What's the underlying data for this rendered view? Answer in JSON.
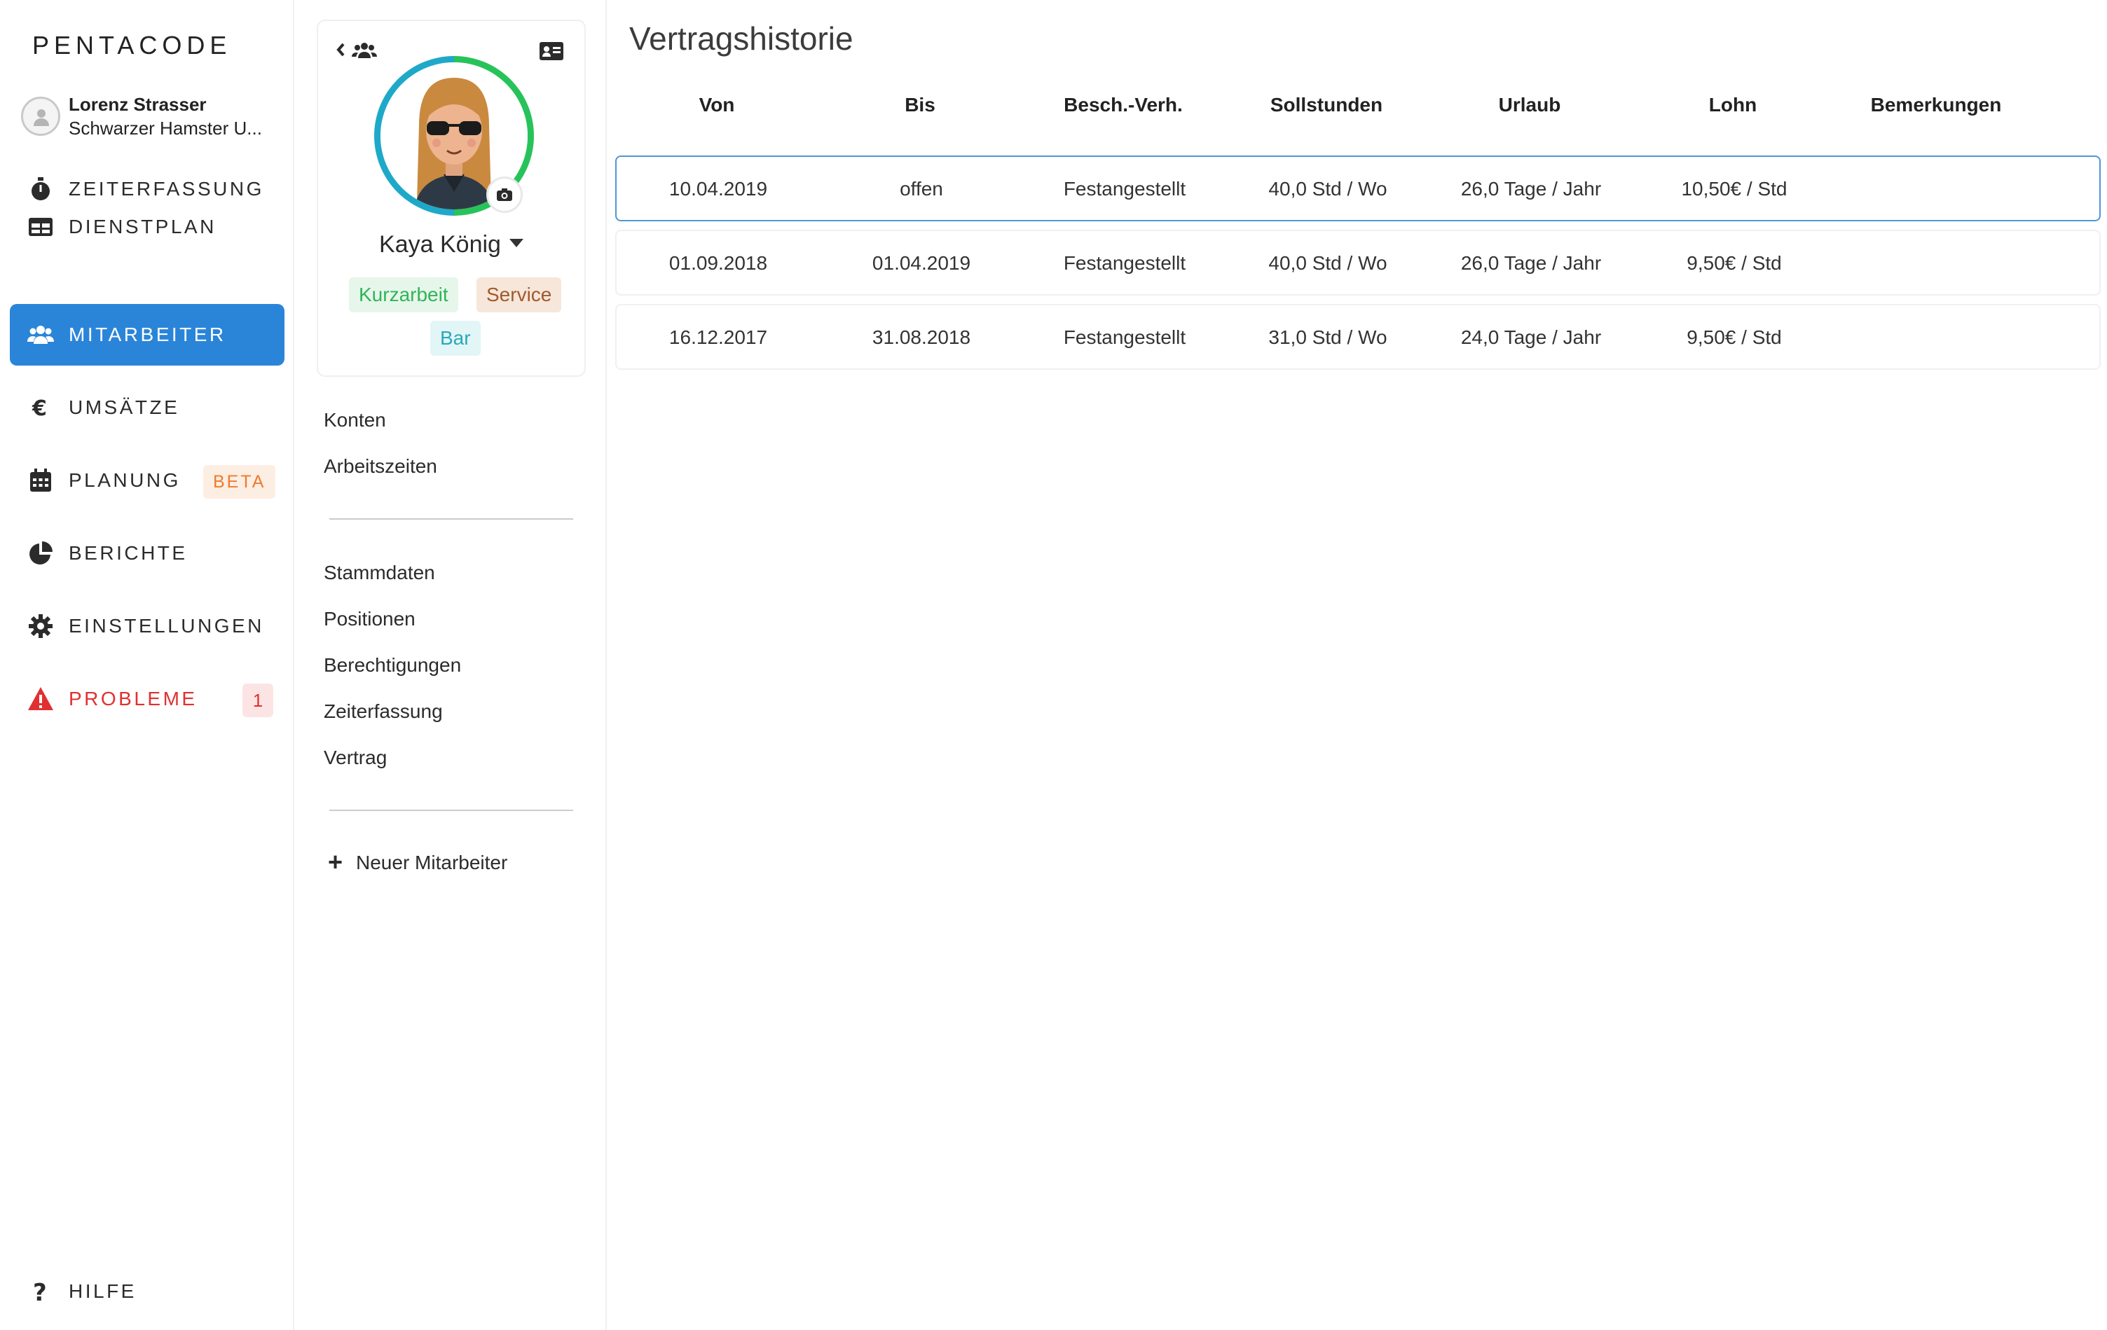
{
  "app": {
    "logo": "PENTACODE"
  },
  "user": {
    "name": "Lorenz Strasser",
    "company": "Schwarzer Hamster U..."
  },
  "nav": {
    "items": [
      {
        "label": "ZEITERFASSUNG",
        "icon": "stopwatch-icon"
      },
      {
        "label": "DIENSTPLAN",
        "icon": "table-icon"
      },
      {
        "label": "MITARBEITER",
        "icon": "users-icon",
        "active": true
      },
      {
        "label": "UMSÄTZE",
        "icon": "euro-icon"
      },
      {
        "label": "PLANUNG",
        "icon": "calendar-icon",
        "badge": "BETA"
      },
      {
        "label": "BERICHTE",
        "icon": "pie-chart-icon"
      },
      {
        "label": "EINSTELLUNGEN",
        "icon": "gear-icon"
      },
      {
        "label": "PROBLEME",
        "icon": "warning-icon",
        "badge": "1"
      }
    ],
    "help": {
      "label": "HILFE",
      "icon": "question-icon"
    }
  },
  "colors": {
    "accent": "#2a85d9",
    "danger": "#e03131",
    "beta": "#f07a2c"
  },
  "employee": {
    "name": "Kaya König",
    "tags": [
      {
        "label": "Kurzarbeit",
        "color": "#2fb55a"
      },
      {
        "label": "Service",
        "color": "#a05a2c"
      },
      {
        "label": "Bar",
        "color": "#2aa9b8"
      }
    ]
  },
  "employee_nav": {
    "group1": [
      "Konten",
      "Arbeitszeiten"
    ],
    "group2": [
      "Stammdaten",
      "Positionen",
      "Berechtigungen",
      "Zeiterfassung",
      "Vertrag"
    ],
    "new_employee": "Neuer Mitarbeiter"
  },
  "contract_history": {
    "title": "Vertragshistorie",
    "columns": [
      "Von",
      "Bis",
      "Besch.-Verh.",
      "Sollstunden",
      "Urlaub",
      "Lohn",
      "Bemerkungen"
    ],
    "rows": [
      [
        "10.04.2019",
        "offen",
        "Festangestellt",
        "40,0 Std / Wo",
        "26,0 Tage / Jahr",
        "10,50€ / Std",
        ""
      ],
      [
        "01.09.2018",
        "01.04.2019",
        "Festangestellt",
        "40,0 Std / Wo",
        "26,0 Tage / Jahr",
        "9,50€ / Std",
        ""
      ],
      [
        "16.12.2017",
        "31.08.2018",
        "Festangestellt",
        "31,0 Std / Wo",
        "24,0 Tage / Jahr",
        "9,50€ / Std",
        ""
      ]
    ]
  }
}
